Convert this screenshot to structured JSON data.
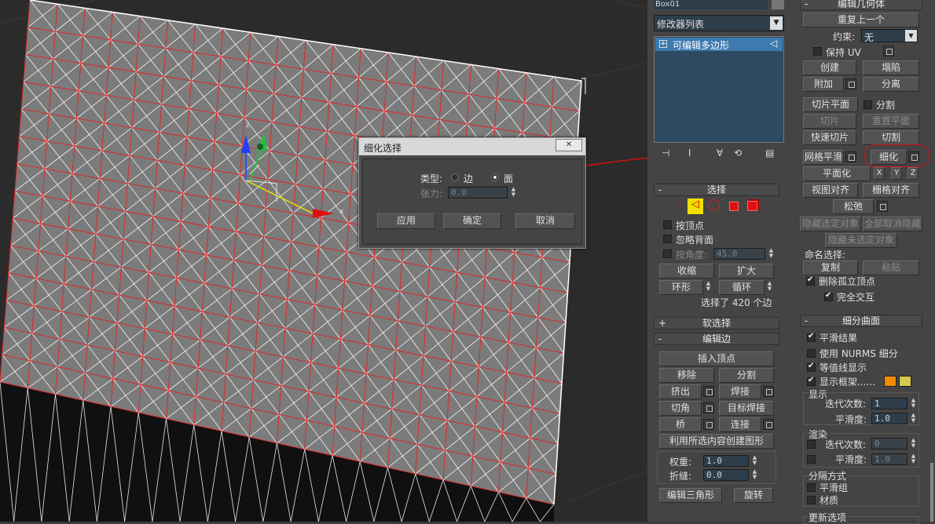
{
  "object_name": "Box01",
  "modifier_list_label": "修改器列表",
  "stack_item": "可编辑多边形",
  "dialog": {
    "title": "细化选择",
    "type_label": "类型:",
    "opt_edge": "边",
    "opt_face": "面",
    "tension_label": "张力:",
    "tension_value": "0.0",
    "apply": "应用",
    "ok": "确定",
    "cancel": "取消",
    "close": "✕"
  },
  "viewport": {
    "axis_x": "x",
    "axis_z": "z"
  },
  "edit_geometry": {
    "header": "编辑几何体",
    "repeat_last": "重复上一个",
    "constraint_label": "约束:",
    "constraint_value": "无",
    "preserve_uv": "保持 UV",
    "create": "创建",
    "collapse": "塌陷",
    "attach": "附加",
    "detach": "分离",
    "slice_plane": "切片平面",
    "split": "分割",
    "slice": "切片",
    "reset_plane": "重置平面",
    "quick_slice": "快速切片",
    "cut": "切割",
    "meshsmooth": "网格平滑",
    "tessellate": "细化",
    "make_planar": "平面化",
    "x": "X",
    "y": "Y",
    "z": "Z",
    "view_align": "视图对齐",
    "grid_align": "栅格对齐",
    "relax": "松弛",
    "hide_selected": "隐藏选定对象",
    "unhide_all": "全部取消隐藏",
    "hide_unselected": "隐藏未选定对象",
    "named_sel": "命名选择:",
    "copy": "复制",
    "paste": "粘贴",
    "delete_isolated": "删除孤立顶点",
    "full_interactivity": "完全交互"
  },
  "selection": {
    "header": "选择",
    "by_vertex": "按顶点",
    "ignore_backfacing": "忽略背面",
    "by_angle": "按角度:",
    "angle_value": "45.0",
    "shrink": "收缩",
    "grow": "扩大",
    "ring": "环形",
    "loop": "循环",
    "status": "选择了 420 个边"
  },
  "soft_selection": {
    "header": "软选择"
  },
  "edit_edges": {
    "header": "编辑边",
    "insert_vertex": "插入顶点",
    "remove": "移除",
    "split": "分割",
    "extrude": "挤出",
    "weld": "焊接",
    "chamfer": "切角",
    "target_weld": "目标焊接",
    "bridge": "桥",
    "connect": "连接",
    "create_shape": "利用所选内容创建图形",
    "weight_label": "权重:",
    "weight_value": "1.0",
    "crease_label": "折缝:",
    "crease_value": "0.0",
    "edit_tri": "编辑三角形",
    "turn": "旋转"
  },
  "subdivision": {
    "header": "细分曲面",
    "smooth_result": "平滑结果",
    "use_nurms": "使用 NURMS 细分",
    "isoline": "等值线显示",
    "show_cage": "显示框架......",
    "display": "显示",
    "iterations_label": "迭代次数:",
    "iterations_value": "1",
    "smoothness_label": "平滑度:",
    "smoothness_value": "1.0",
    "render": "渲染",
    "r_iterations_label": "迭代次数:",
    "r_iterations_value": "0",
    "r_smoothness_label": "平滑度:",
    "r_smoothness_value": "1.0",
    "separate_by": "分隔方式",
    "smoothing_groups": "平滑组",
    "materials": "材质",
    "update_options": "更新选项"
  },
  "colors": {
    "cage1": "#f08c00",
    "cage2": "#d8c850",
    "annot": "#d01010"
  }
}
